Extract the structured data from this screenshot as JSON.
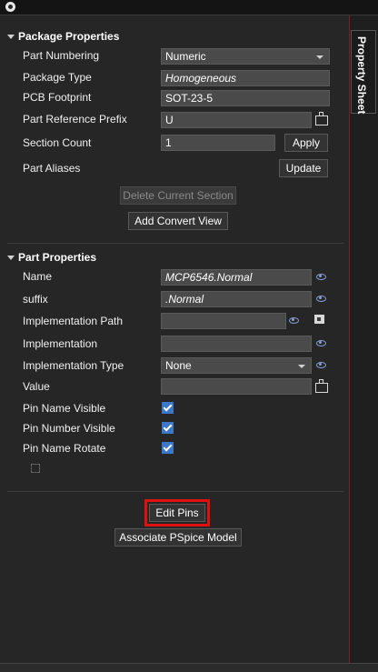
{
  "side_tab": {
    "label": "Property Sheet"
  },
  "package_properties": {
    "header": "Package Properties",
    "part_numbering": {
      "label": "Part Numbering",
      "value": "Numeric"
    },
    "package_type": {
      "label": "Package Type",
      "value": "Homogeneous"
    },
    "pcb_footprint": {
      "label": "PCB Footprint",
      "value": "SOT-23-5"
    },
    "part_reference_prefix": {
      "label": "Part Reference Prefix",
      "value": "U"
    },
    "section_count": {
      "label": "Section Count",
      "value": "1",
      "apply_label": "Apply"
    },
    "part_aliases": {
      "label": "Part Aliases",
      "update_label": "Update"
    },
    "delete_section_label": "Delete Current Section",
    "add_convert_view_label": "Add Convert View"
  },
  "part_properties": {
    "header": "Part Properties",
    "name": {
      "label": "Name",
      "value": "MCP6546.Normal"
    },
    "suffix": {
      "label": "suffix",
      "value": ".Normal"
    },
    "implementation_path": {
      "label": "Implementation Path",
      "value": ""
    },
    "implementation": {
      "label": "Implementation",
      "value": ""
    },
    "implementation_type": {
      "label": "Implementation Type",
      "value": "None"
    },
    "value": {
      "label": "Value",
      "value": ""
    },
    "pin_name_visible": {
      "label": "Pin Name Visible",
      "checked": true
    },
    "pin_number_visible": {
      "label": "Pin Number Visible",
      "checked": true
    },
    "pin_name_rotate": {
      "label": "Pin Name Rotate",
      "checked": true
    }
  },
  "actions": {
    "edit_pins_label": "Edit Pins",
    "associate_pspice_label": "Associate PSpice Model"
  },
  "colors": {
    "panel_bg": "#262626",
    "field_bg": "#4a4a4a",
    "checkbox": "#3c78c8",
    "highlight": "#e01010",
    "border_accent": "#8b1a1a"
  }
}
